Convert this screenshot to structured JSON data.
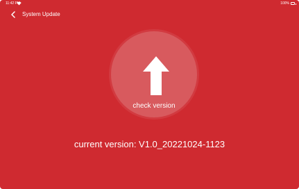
{
  "status_bar": {
    "time": "11:42 PM",
    "battery": "100%",
    "icons": [
      "wifi-icon",
      "battery-icon"
    ]
  },
  "header": {
    "title": "System Update",
    "back_icon": "chevron-left-icon"
  },
  "main": {
    "check_label": "check version",
    "check_icon": "upload-arrow-icon",
    "version_text": "current version: V1.0_20221024-1123"
  },
  "colors": {
    "background": "#cf2a30",
    "circle_fill": "#d85a5e",
    "text": "#ffffff"
  }
}
